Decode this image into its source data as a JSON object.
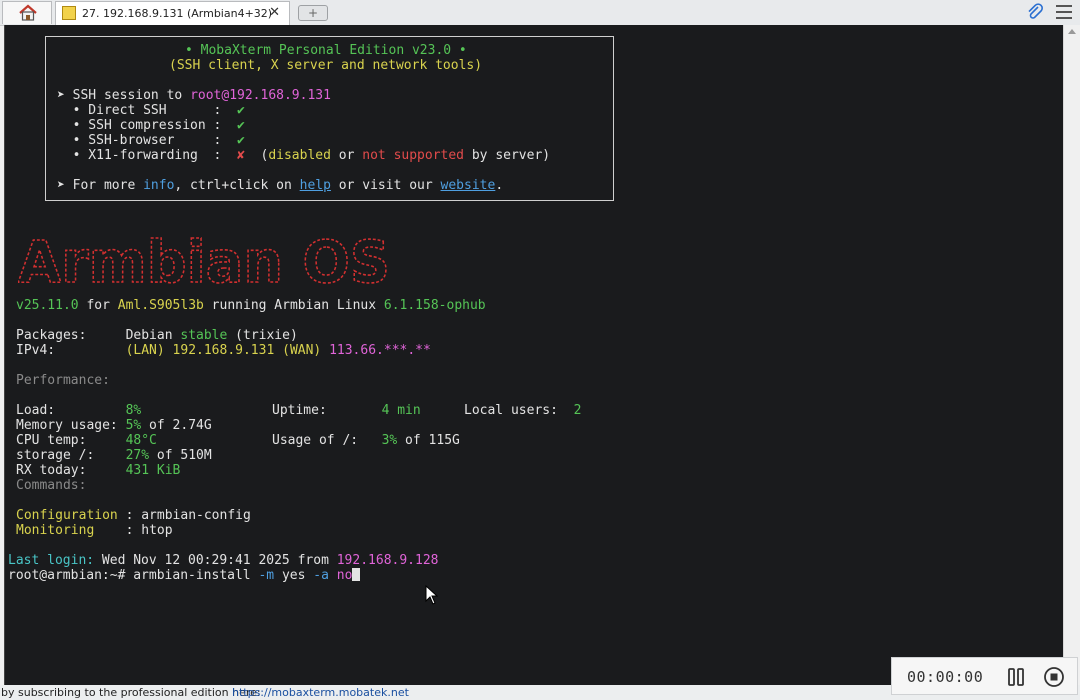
{
  "tabs": {
    "home_icon": "home-icon",
    "session_label": "27. 192.168.9.131 (Armbian4+32)",
    "close_glyph": "✕",
    "new_tab_glyph": "+"
  },
  "banner": {
    "line1": "• MobaXterm Personal Edition v23.0 •",
    "line2": "(SSH client, X server and network tools)",
    "ssh_prefix": "➤ SSH session to ",
    "ssh_host": "root@192.168.9.131",
    "direct_ssh_label": "  • Direct SSH      :  ",
    "compression_label": "  • SSH compression :  ",
    "browser_label": "  • SSH-browser     :  ",
    "x11_label": "  • X11-forwarding  :  ",
    "check": "✔",
    "cross": "✘",
    "x11_open": "  (",
    "x11_disabled": "disabled",
    "x11_or": " or ",
    "x11_not_supported": "not supported",
    "x11_by_server": " by server)",
    "more_prefix": "➤ For more ",
    "more_info": "info",
    "more_mid": ", ctrl+click on ",
    "more_help": "help",
    "more_visit": " or visit our ",
    "more_website": "website",
    "more_end": "."
  },
  "motd": {
    "logo_text": "Armbian OS",
    "version": "v25.11.0",
    "for_text": " for ",
    "board": "Aml.S905l3b",
    "running": " running Armbian Linux ",
    "kernel": "6.1.158-ophub",
    "packages_label": "Packages:     ",
    "packages_debian": "Debian ",
    "packages_stable": "stable",
    "packages_trixie": " (trixie)",
    "ipv4_label": "IPv4:         ",
    "ipv4_lan": "(LAN) 192.168.9.131 (WAN) ",
    "ipv4_wan": "113.66.*",
    "ipv4_wan_mask": "**.**",
    "performance": "Performance:",
    "load_label": "Load:         ",
    "load_value": "8%",
    "uptime_label": "Uptime:       ",
    "uptime_value": "4 min",
    "users_label": "Local users:  ",
    "users_value": "2",
    "mem_label": "Memory usage: ",
    "mem_value": "5%",
    "mem_of": " of 2.74G",
    "cpu_label": "CPU temp:     ",
    "cpu_value": "48°C",
    "usage_label": "Usage of /:   ",
    "usage_value": "3%",
    "usage_of": " of 115G",
    "storage_label": "storage /:    ",
    "storage_value": "27%",
    "storage_of": " of 510M",
    "rx_label": "RX today:     ",
    "rx_value": "431 KiB",
    "commands": "Commands:",
    "config_label": "Configuration",
    "config_value": " : armbian-config",
    "monitoring_label": "Monitoring",
    "monitoring_value": "    : htop"
  },
  "login": {
    "last_label": "Last login:",
    "last_date": " Wed Nov 12 00:29:41 2025 from ",
    "last_ip": "192.168.9.128",
    "prompt": "root@armbian:~# ",
    "command": "armbian-install ",
    "flag_m": "-m",
    "val_m": " yes ",
    "flag_a": "-a",
    "val_space": " ",
    "val_a": "no"
  },
  "statusbar": {
    "text": "by subscribing to the professional edition here:",
    "link": "https://mobaxterm.mobatek.net"
  },
  "recorder": {
    "time": "00:00:00"
  }
}
